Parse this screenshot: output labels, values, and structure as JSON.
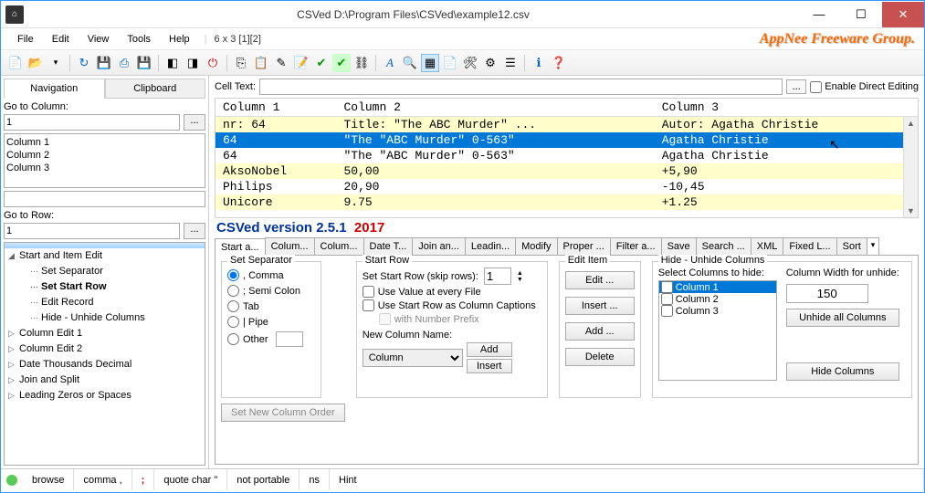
{
  "window": {
    "title": "CSVed D:\\Program Files\\CSVed\\example12.csv"
  },
  "menu": {
    "file": "File",
    "edit": "Edit",
    "view": "View",
    "tools": "Tools",
    "help": "Help",
    "stat": "6 x 3 [1][2]"
  },
  "brand": "AppNee Freeware Group.",
  "left": {
    "tab_nav": "Navigation",
    "tab_clip": "Clipboard",
    "go_col": "Go to Column:",
    "go_col_v": "1",
    "cols": [
      "Column 1",
      "Column 2",
      "Column 3"
    ],
    "go_row": "Go to Row:",
    "go_row_v": "1",
    "tree": [
      {
        "t": "Start and Item Edit",
        "l": 1,
        "e": true
      },
      {
        "t": "Set Separator",
        "l": 2
      },
      {
        "t": "Set Start Row",
        "l": 2,
        "b": true
      },
      {
        "t": "Edit Record",
        "l": 2
      },
      {
        "t": "Hide - Unhide Columns",
        "l": 2
      },
      {
        "t": "Column Edit 1",
        "l": 1
      },
      {
        "t": "Column Edit 2",
        "l": 1
      },
      {
        "t": "Date Thousands Decimal",
        "l": 1
      },
      {
        "t": "Join and Split",
        "l": 1
      },
      {
        "t": "Leading Zeros or Spaces",
        "l": 1
      }
    ]
  },
  "celltext": {
    "label": "Cell Text:",
    "chk": "Enable Direct Editing"
  },
  "grid": {
    "headers": [
      "Column 1",
      "Column 2",
      "Column 3"
    ],
    "rows": [
      [
        "nr: 64",
        "Title: \"The ABC Murder\" ...",
        "Autor: Agatha Christie"
      ],
      [
        "64",
        "\"The \"ABC Murder\" 0-563\"",
        "Agatha Christie"
      ],
      [
        "64",
        "\"The \"ABC Murder\" 0-563\"",
        "Agatha Christie"
      ],
      [
        "AksoNobel",
        "50,00",
        "+5,90"
      ],
      [
        "Philips",
        "20,90",
        "-10,45"
      ],
      [
        "Unicore",
        "9.75",
        "+1.25"
      ]
    ]
  },
  "version": {
    "a": "CSVed version 2.5.1",
    "b": "2017"
  },
  "etabs": [
    "Start a...",
    "Colum...",
    "Colum...",
    "Date T...",
    "Join an...",
    "Leadin...",
    "Modify",
    "Proper ...",
    "Filter a...",
    "Save",
    "Search ...",
    "XML",
    "Fixed L...",
    "Sort"
  ],
  "edit": {
    "sep": {
      "title": "Set Separator",
      "comma": ", Comma",
      "semi": "; Semi Colon",
      "tab": "Tab",
      "pipe": "| Pipe",
      "other": "Other"
    },
    "startrow": {
      "title": "Start Row",
      "label": "Set Start Row (skip rows):",
      "val": "1",
      "u1": "Use Value at every File",
      "u2": "Use Start Row as Column Captions",
      "u3": "with Number Prefix",
      "newcol": "New Column Name:",
      "colval": "Column",
      "add": "Add",
      "insert": "Insert"
    },
    "setorder": "Set New Column Order",
    "item": {
      "title": "Edit Item",
      "edit": "Edit ...",
      "insert": "Insert ...",
      "add": "Add ...",
      "delete": "Delete"
    },
    "hide": {
      "title": "Hide - Unhide Columns",
      "sel": "Select Columns to hide:",
      "width": "Column Width for unhide:",
      "wval": "150",
      "unhide": "Unhide all Columns",
      "hidebtn": "Hide Columns",
      "cols": [
        "Column 1",
        "Column 2",
        "Column 3"
      ]
    }
  },
  "status": {
    "browse": "browse",
    "comma": "comma ,",
    "semi": ";",
    "quote": "quote char \"",
    "port": "not portable",
    "ns": "ns",
    "hint": "Hint"
  }
}
